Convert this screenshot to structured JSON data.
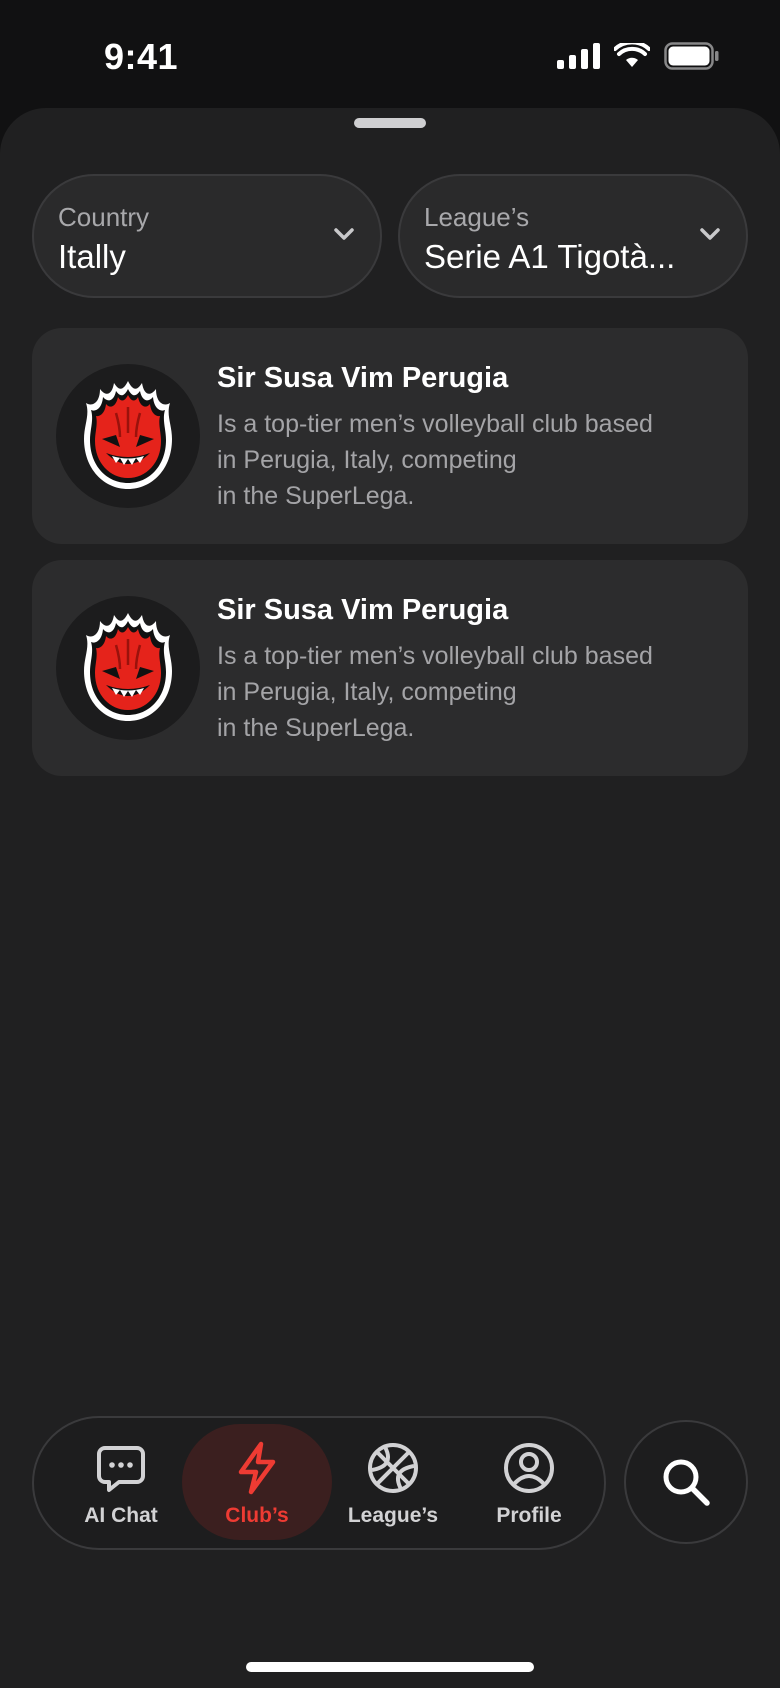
{
  "status_bar": {
    "time": "9:41"
  },
  "filters": {
    "country": {
      "label": "Country",
      "value": "Itally"
    },
    "league": {
      "label": "League’s",
      "value": "Serie A1 Tigotà..."
    }
  },
  "clubs": [
    {
      "name": "Sir Susa Vim Perugia",
      "description_lines": [
        "Is a top-tier men’s volleyball club based",
        "in Perugia, Italy, competing",
        "in the SuperLega."
      ]
    },
    {
      "name": "Sir Susa Vim Perugia",
      "description_lines": [
        "Is a top-tier men’s volleyball club based",
        "in Perugia, Italy, competing",
        "in the SuperLega."
      ]
    }
  ],
  "tabbar": {
    "items": [
      {
        "label": "AI Chat",
        "icon": "chat-bubble-icon"
      },
      {
        "label": "Club’s",
        "icon": "lightning-icon",
        "active": true
      },
      {
        "label": "League’s",
        "icon": "basketball-icon"
      },
      {
        "label": "Profile",
        "icon": "user-circle-icon"
      }
    ],
    "search_icon": "search-icon"
  },
  "colors": {
    "accent": "#EE3B33",
    "background": "#202021",
    "card": "#2C2C2D",
    "muted_text": "#A4A4A7"
  }
}
